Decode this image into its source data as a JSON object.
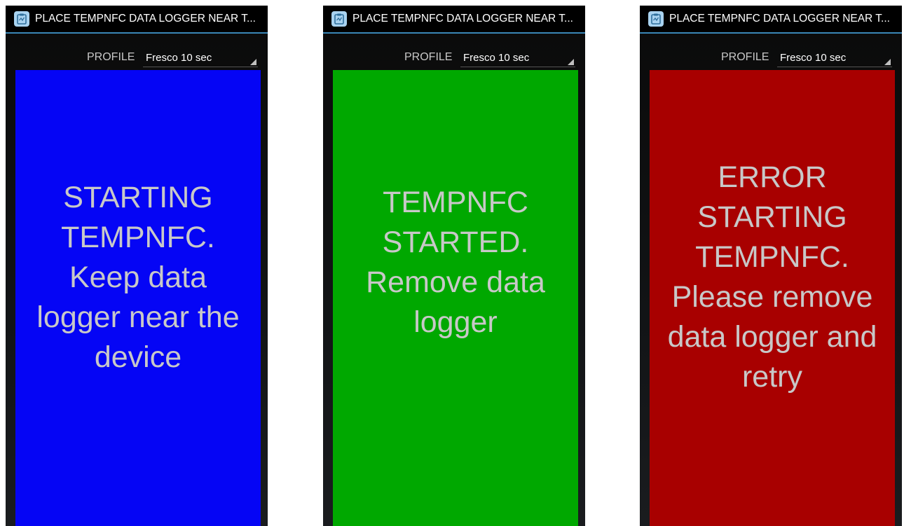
{
  "screens": [
    {
      "title": "PLACE TEMPNFC DATA LOGGER NEAR T...",
      "profile_label": "PROFILE",
      "profile_value": "Fresco 10 sec",
      "status_color": "#0505f5",
      "status_lines": [
        "STARTING",
        "TEMPNFC.",
        "Keep data",
        "logger near the",
        "device"
      ]
    },
    {
      "title": "PLACE TEMPNFC DATA LOGGER NEAR T...",
      "profile_label": "PROFILE",
      "profile_value": "Fresco 10 sec",
      "status_color": "#00a800",
      "status_lines": [
        "TEMPNFC",
        "STARTED.",
        "Remove data",
        "logger"
      ]
    },
    {
      "title": "PLACE TEMPNFC DATA LOGGER NEAR T...",
      "profile_label": "PROFILE",
      "profile_value": "Fresco 10 sec",
      "status_color": "#a80000",
      "status_lines": [
        "ERROR",
        "STARTING",
        "TEMPNFC.",
        "Please remove",
        "data logger and",
        "retry"
      ]
    }
  ],
  "icons": {
    "app_icon": "clipboard-app-icon",
    "spinner_arrow": "dropdown-corner-icon"
  }
}
